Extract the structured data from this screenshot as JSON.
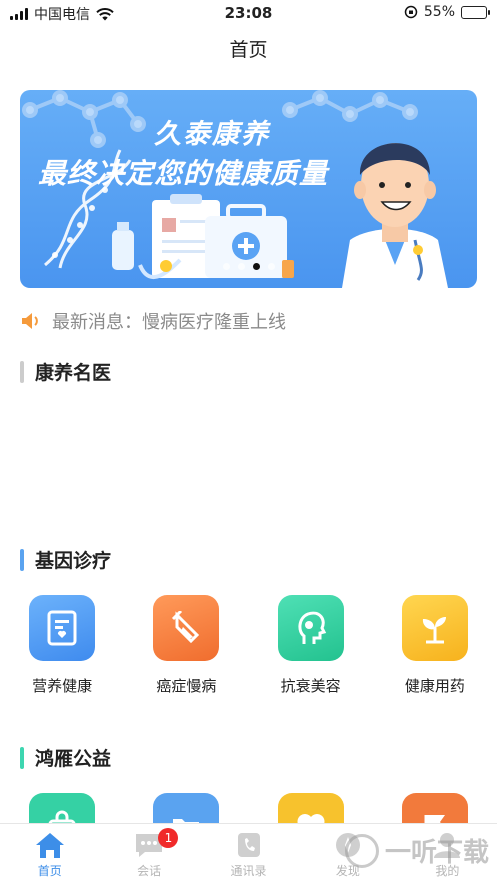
{
  "status_bar": {
    "carrier": "中国电信",
    "time": "23:08",
    "battery_percent_label": "55%",
    "battery_level": 0.55
  },
  "navbar": {
    "title": "首页"
  },
  "banner": {
    "line1": "久泰康养",
    "line2": "最终决定您的健康质量",
    "dots": 4,
    "active_dot": 2
  },
  "news": {
    "text": "最新消息：慢病医疗隆重上线",
    "icon": "speaker-icon"
  },
  "sections": {
    "doctors": {
      "title": "康养名医",
      "accent": "#cccccc"
    },
    "gene": {
      "title": "基因诊疗",
      "accent": "#5aa3f0",
      "items": [
        {
          "label": "营养健康",
          "icon": "document-icon",
          "color_from": "#6cb2fb",
          "color_to": "#3f8bee"
        },
        {
          "label": "癌症慢病",
          "icon": "test-tube-icon",
          "color_from": "#ff9a5a",
          "color_to": "#f06d2e"
        },
        {
          "label": "抗衰美容",
          "icon": "face-profile-icon",
          "color_from": "#4fe0b5",
          "color_to": "#23c28f"
        },
        {
          "label": "健康用药",
          "icon": "sprout-icon",
          "color_from": "#ffd650",
          "color_to": "#f7b21d"
        }
      ]
    },
    "charity": {
      "title": "鸿雁公益",
      "accent": "#3dd6b0",
      "items": [
        {
          "icon": "bag-icon",
          "color": "#35d1a4"
        },
        {
          "icon": "folder-icon",
          "color": "#5aa3f0"
        },
        {
          "icon": "heart-icon",
          "color": "#f7c22d"
        },
        {
          "icon": "flag-icon",
          "color": "#f27a3c"
        }
      ]
    }
  },
  "tabbar": {
    "items": [
      {
        "label": "首页",
        "icon": "home-icon",
        "active": true
      },
      {
        "label": "会话",
        "icon": "chat-icon",
        "badge": "1"
      },
      {
        "label": "通讯录",
        "icon": "phone-icon"
      },
      {
        "label": "发现",
        "icon": "compass-icon"
      },
      {
        "label": "我的",
        "icon": "user-icon"
      }
    ]
  },
  "watermark": {
    "text": "一听下载"
  },
  "colors": {
    "primary": "#3d8ee8",
    "banner": "#5aa3f4",
    "badge": "#f02a2a"
  }
}
